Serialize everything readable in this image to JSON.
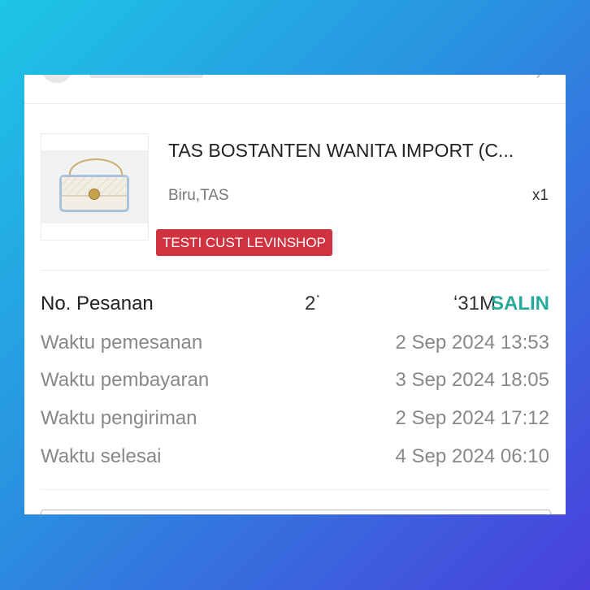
{
  "product": {
    "title": "TAS BOSTANTEN WANITA IMPORT (C...",
    "variant": "Biru,TAS",
    "quantity": "x1"
  },
  "promo_badge": "TESTI CUST LEVINSHOP",
  "order": {
    "label": "No. Pesanan",
    "number_visible_start": "2˙",
    "number_visible_end": "ʻ31M",
    "copy_label": "SALIN"
  },
  "details": [
    {
      "label": "Waktu pemesanan",
      "value": "2 Sep 2024 13:53"
    },
    {
      "label": "Waktu pembayaran",
      "value": "3 Sep 2024 18:05"
    },
    {
      "label": "Waktu pengiriman",
      "value": "2 Sep 2024 17:12"
    },
    {
      "label": "Waktu selesai",
      "value": "4 Sep 2024 06:10"
    }
  ],
  "colors": {
    "accent": "#26aa99",
    "badge": "#d0323f"
  }
}
